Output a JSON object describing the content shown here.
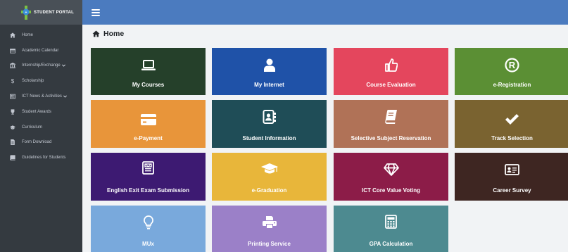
{
  "brand": {
    "name": "STUDENT PORTAL"
  },
  "sidebar": {
    "items": [
      {
        "label": "Home",
        "icon": "home-icon",
        "dropdown": false
      },
      {
        "label": "Academic Calendar",
        "icon": "calendar-icon",
        "dropdown": false
      },
      {
        "label": "Internship/Exchange",
        "icon": "institution-icon",
        "dropdown": true
      },
      {
        "label": "Scholarship",
        "icon": "dollar-icon",
        "dropdown": false
      },
      {
        "label": "ICT News & Activities",
        "icon": "newspaper-icon",
        "dropdown": true
      },
      {
        "label": "Student Awards",
        "icon": "trophy-icon",
        "dropdown": false
      },
      {
        "label": "Curriculum",
        "icon": "graduation-cap-icon",
        "dropdown": false
      },
      {
        "label": "Form Download",
        "icon": "file-icon",
        "dropdown": false
      },
      {
        "label": "Guidelines for Students",
        "icon": "book-icon",
        "dropdown": false
      }
    ]
  },
  "topbar": {
    "menu_icon": "hamburger-menu-icon",
    "color": "#4b7bbf"
  },
  "content": {
    "title": "Home",
    "title_icon": "home-icon"
  },
  "tiles": [
    {
      "label": "My Courses",
      "icon": "laptop-icon",
      "color": "#25402a"
    },
    {
      "label": "My Internet",
      "icon": "user-icon",
      "color": "#1f52a8"
    },
    {
      "label": "Course Evaluation",
      "icon": "thumbs-up-icon",
      "color": "#e4465d"
    },
    {
      "label": "e-Registration",
      "icon": "registered-icon",
      "color": "#5b8f34"
    },
    {
      "label": "e-Payment",
      "icon": "credit-card-icon",
      "color": "#e8953a"
    },
    {
      "label": "Student Information",
      "icon": "address-book-icon",
      "color": "#1f4d57"
    },
    {
      "label": "Selective Subject Reservation",
      "icon": "book-icon",
      "color": "#b07257"
    },
    {
      "label": "Track Selection",
      "icon": "check-icon",
      "color": "#7a6330"
    },
    {
      "label": "English Exit Exam Submission",
      "icon": "newspaper-icon",
      "color": "#3d1a72"
    },
    {
      "label": "e-Graduation",
      "icon": "graduation-cap-icon",
      "color": "#e8b63a"
    },
    {
      "label": "ICT Core Value Voting",
      "icon": "gem-icon",
      "color": "#8c1c48"
    },
    {
      "label": "Career Survey",
      "icon": "id-card-icon",
      "color": "#3e2622"
    },
    {
      "label": "MUx",
      "icon": "lightbulb-icon",
      "color": "#79a9dc"
    },
    {
      "label": "Printing Service",
      "icon": "print-icon",
      "color": "#9b80c8"
    },
    {
      "label": "GPA Calculation",
      "icon": "calculator-icon",
      "color": "#4d8a90"
    }
  ]
}
